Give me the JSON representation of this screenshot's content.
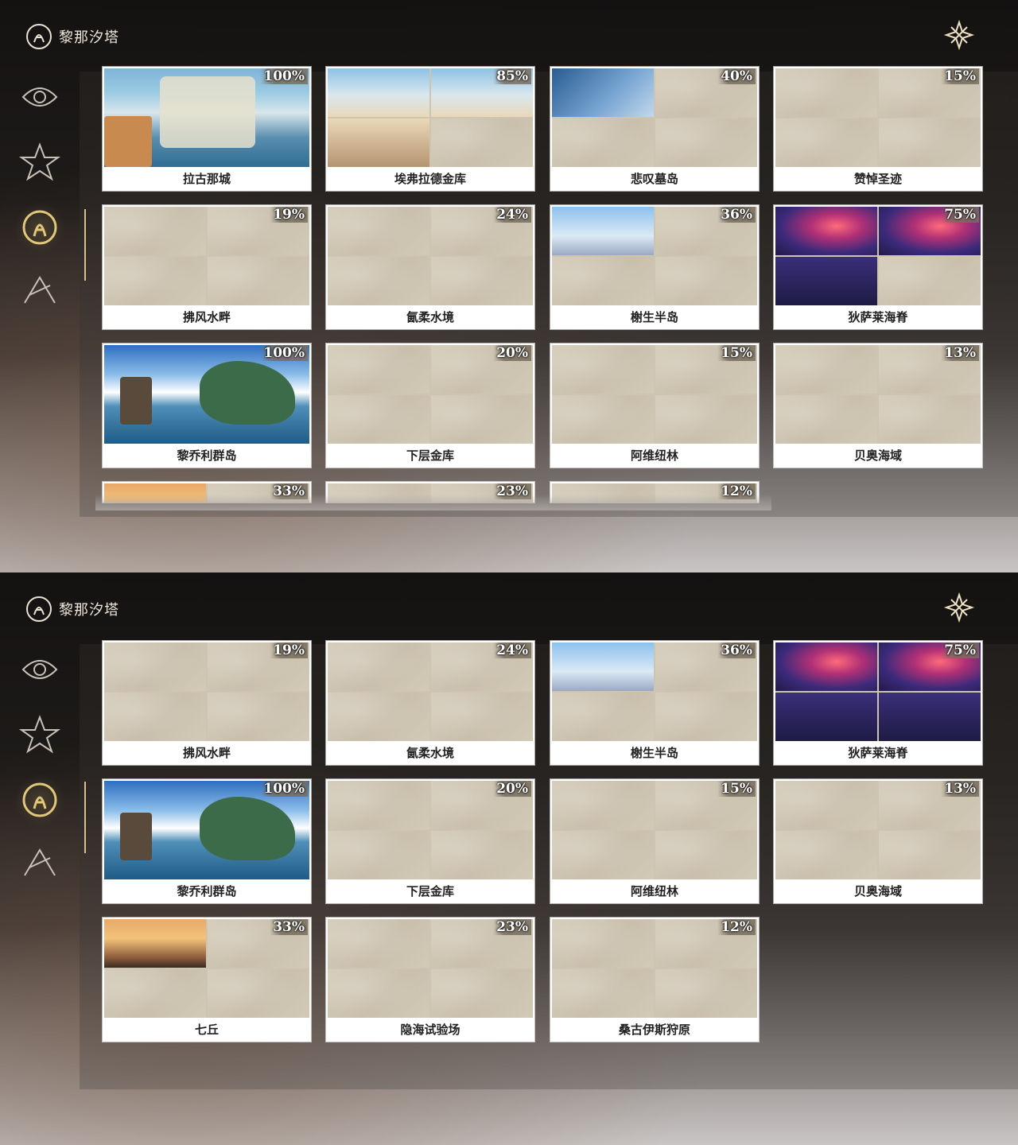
{
  "app": {
    "title": "黎那汐塔",
    "nav_items": [
      "region-icon-1",
      "region-icon-2",
      "region-icon-3-active",
      "region-icon-4"
    ]
  },
  "regions": [
    {
      "name": "拉古那城",
      "percent": "100%",
      "thumb": "city"
    },
    {
      "name": "埃弗拉德金库",
      "percent": "85%",
      "thumb": "sky"
    },
    {
      "name": "悲叹墓岛",
      "percent": "40%",
      "thumb": "swirl"
    },
    {
      "name": "赞悼圣迹",
      "percent": "15%",
      "thumb": "map"
    },
    {
      "name": "拂风水畔",
      "percent": "19%",
      "thumb": "map"
    },
    {
      "name": "氤柔水境",
      "percent": "24%",
      "thumb": "map"
    },
    {
      "name": "榭生半岛",
      "percent": "36%",
      "thumb": "peak"
    },
    {
      "name": "狄萨莱海脊",
      "percent": "75%",
      "thumb": "nebula"
    },
    {
      "name": "黎乔利群岛",
      "percent": "100%",
      "thumb": "island"
    },
    {
      "name": "下层金库",
      "percent": "20%",
      "thumb": "map"
    },
    {
      "name": "阿维纽林",
      "percent": "15%",
      "thumb": "map"
    },
    {
      "name": "贝奥海域",
      "percent": "13%",
      "thumb": "map"
    },
    {
      "name": "七丘",
      "percent": "33%",
      "thumb": "sunset"
    },
    {
      "name": "隐海试验场",
      "percent": "23%",
      "thumb": "map"
    },
    {
      "name": "桑古伊斯狩原",
      "percent": "12%",
      "thumb": "map"
    }
  ],
  "colors": {
    "accent": "#d9c08a",
    "card_bg": "#ffffff",
    "map_tile": "#cdc4b1"
  }
}
